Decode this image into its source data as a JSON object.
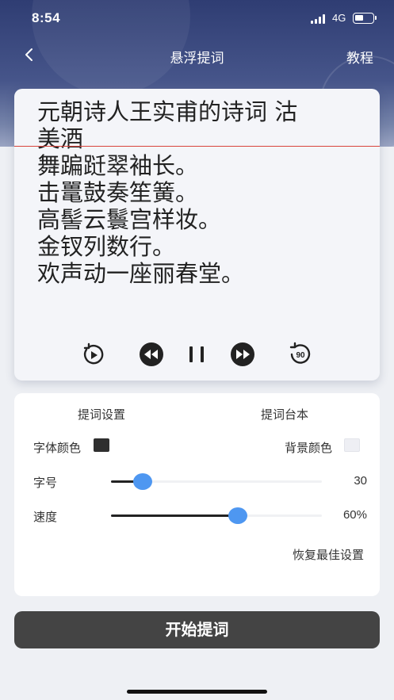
{
  "status_bar": {
    "time": "8:54",
    "network": "4G",
    "icons": [
      "signal-icon",
      "battery-icon"
    ]
  },
  "nav": {
    "title": "悬浮提词",
    "right_link": "教程",
    "back_icon": "chevron-left-icon"
  },
  "prompter": {
    "lines": [
      "元朝诗人王实甫的诗词 沽",
      "美酒",
      "舞蹁跹翠袖长。",
      "击鼍鼓奏笙簧。",
      "高髻云鬟宫样妆。",
      "金钗列数行。",
      "欢声动一座丽春堂。"
    ],
    "controls": [
      "replay-icon",
      "rewind-icon",
      "pause-icon",
      "fast-forward-icon",
      "back-90-icon"
    ]
  },
  "settings": {
    "tabs": [
      "提词设置",
      "提词台本"
    ],
    "font_color_label": "字体颜色",
    "bg_color_label": "背景颜色",
    "font_size_label": "字号",
    "font_size_value": "30",
    "font_size_fraction": 0.15,
    "speed_label": "速度",
    "speed_value": "60%",
    "speed_fraction": 0.6,
    "reset_label": "恢复最佳设置"
  },
  "colors": {
    "accent": "#4e97f1",
    "font_color": "#2f2f2f",
    "bg_color": "#eeeff4",
    "guide_line": "#d9443c",
    "primary_button": "#444444"
  },
  "start_button": "开始提词"
}
